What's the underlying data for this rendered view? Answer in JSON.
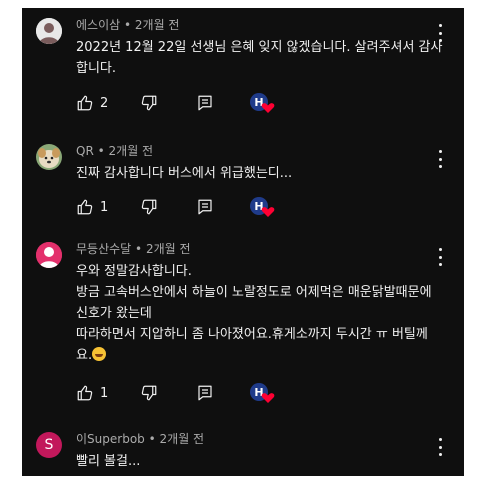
{
  "comments": [
    {
      "author": "에스이삼",
      "separator": "•",
      "time": "2개월 전",
      "lines": [
        "2022년 12월 22일 선생님 은혜 잊지 않겠습니다. 살려주셔서 감사",
        "합니다."
      ],
      "likes": "2",
      "avatar_icon": "person-silhouette-icon",
      "avatar_color": "#e8e8e8"
    },
    {
      "author": "QR",
      "separator": "•",
      "time": "2개월 전",
      "lines": [
        "진짜 감사합니다 버스에서 위급했는디..."
      ],
      "likes": "1",
      "avatar_icon": "dog-photo-icon",
      "avatar_color": "#d9c7a8"
    },
    {
      "author": "무등산수달",
      "separator": "•",
      "time": "2개월 전",
      "lines": [
        "우와 정말감사합니다.",
        "방금 고속버스안에서 하늘이 노랄정도로  어제먹은 매운닭발때문에",
        "신호가 왔는데",
        "따라하면서 지압하니 좀 나아졌어요.휴게소까지 두시간 ㅠ 버틸께",
        "요."
      ],
      "likes": "1",
      "avatar_icon": "person-silhouette-icon",
      "avatar_color": "#e3306c"
    },
    {
      "author": "이Superbob",
      "separator": "•",
      "time": "2개월 전",
      "lines": [
        "빨리 볼걸..."
      ],
      "avatar_letter": "S",
      "avatar_color": "#c2185b"
    }
  ],
  "colors": {
    "panel_bg": "#0f0f0f",
    "text": "#f1f1f1",
    "meta": "#aaaaaa",
    "heart": "#ff0033",
    "creator_badge": "#1f3b8a"
  }
}
